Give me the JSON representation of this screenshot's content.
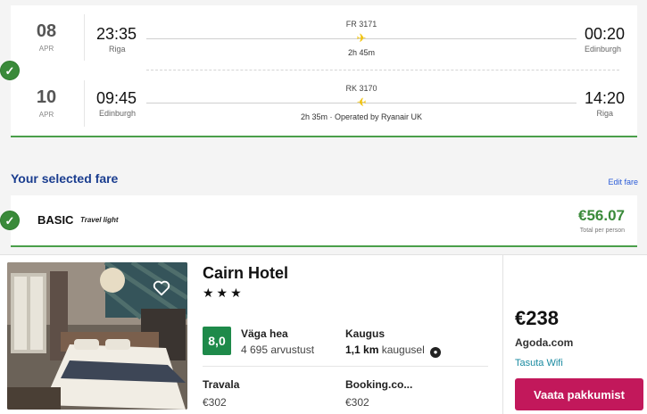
{
  "outbound": {
    "day": "08",
    "month": "APR",
    "dep_time": "23:35",
    "dep_city": "Riga",
    "flight_no": "FR 3171",
    "duration": "2h 45m",
    "arr_time": "00:20",
    "arr_city": "Edinburgh"
  },
  "return": {
    "day": "10",
    "month": "APR",
    "dep_time": "09:45",
    "dep_city": "Edinburgh",
    "flight_no": "RK 3170",
    "duration": "2h 35m · Operated by Ryanair UK",
    "arr_time": "14:20",
    "arr_city": "Riga"
  },
  "fare": {
    "section_title": "Your selected fare",
    "edit_label": "Edit fare",
    "name": "BASIC",
    "subtitle": "Travel light",
    "price": "€56.07",
    "price_note": "Total per person"
  },
  "hotel": {
    "name": "Cairn Hotel",
    "stars": "★★★",
    "score": "8,0",
    "rating_label": "Väga hea",
    "rating_count": "4 695 arvustust",
    "distance_label": "Kaugus",
    "distance_value": "1,1 km",
    "distance_suffix": "kaugusel",
    "distance_info": "●",
    "alt_offers": [
      {
        "provider": "Travala",
        "price": "€302"
      },
      {
        "provider": "Booking.co...",
        "price": "€302"
      }
    ],
    "deal_price": "€238",
    "deal_provider": "Agoda.com",
    "deal_perk": "Tasuta Wifi",
    "deal_button": "Vaata pakkumist"
  },
  "icons": {
    "check": "✓",
    "plane": "✈",
    "favorite": "heart-outline"
  },
  "colors": {
    "accent_green": "#3a8a3a",
    "title_blue": "#1a3d8f",
    "deal_button": "#c2185b",
    "score_badge": "#1e8a4a",
    "plane": "#f0c000"
  }
}
